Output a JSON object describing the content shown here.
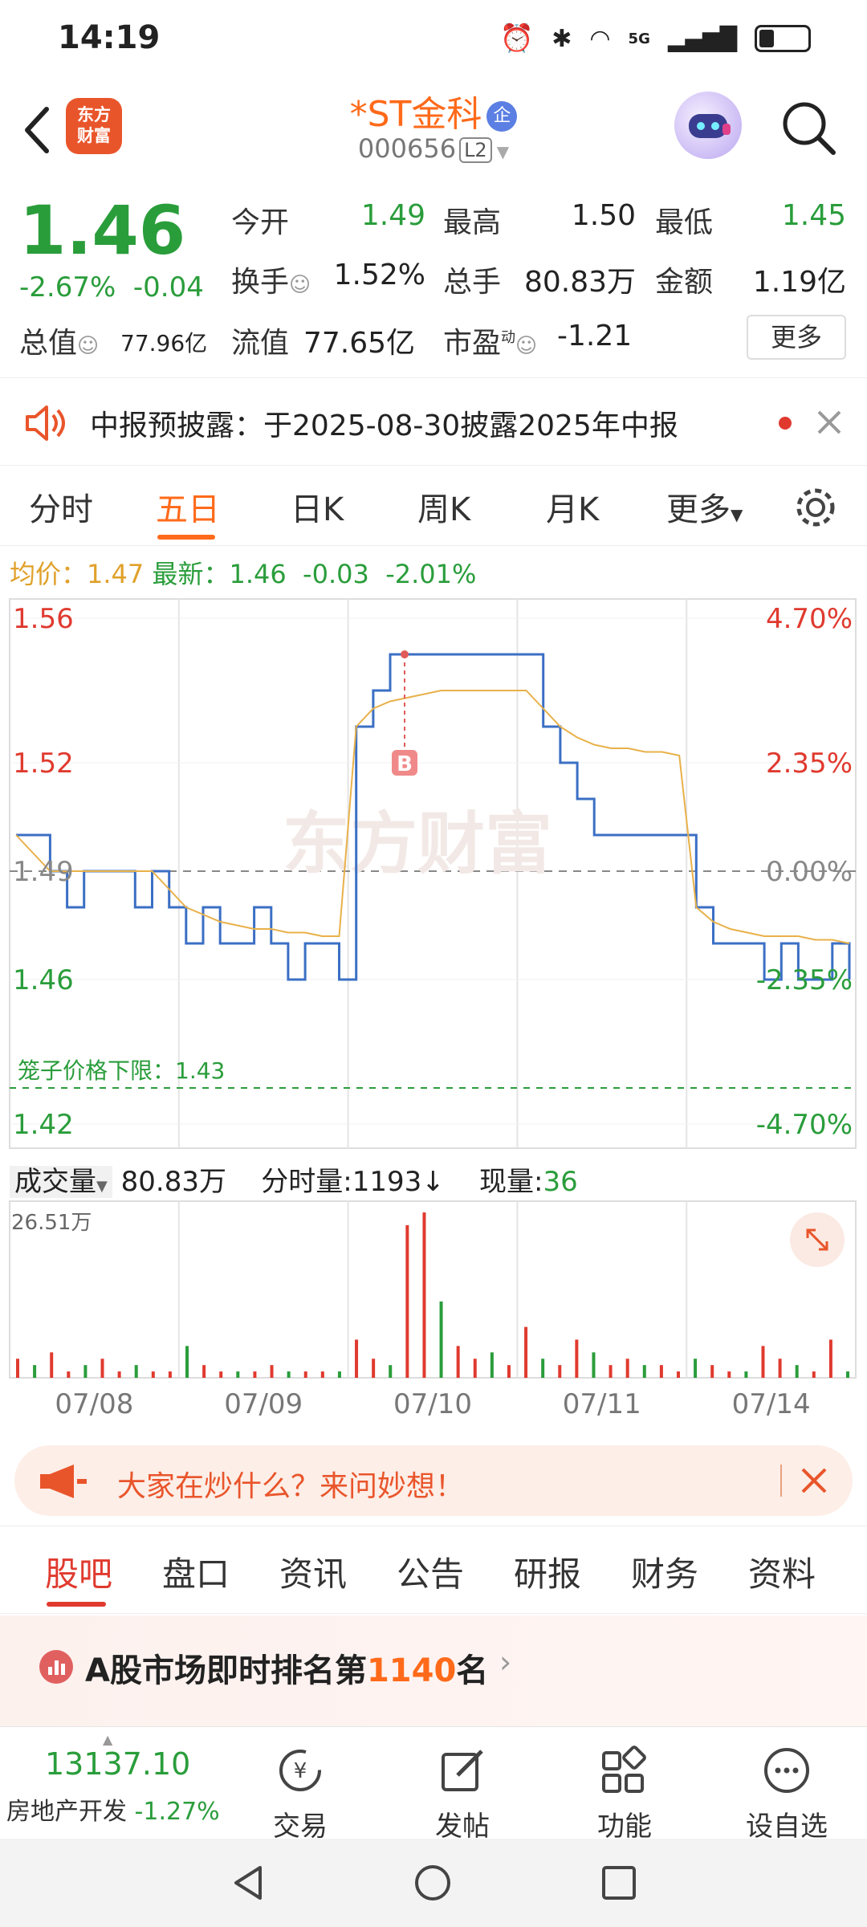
{
  "status": {
    "time": "14:19",
    "network": "5G"
  },
  "header": {
    "brand_logo": "东方财富",
    "stock_name": "*ST金科",
    "corp_badge": "企",
    "stock_code": "000656",
    "level": "L2"
  },
  "quote": {
    "price": "1.46",
    "change_pct": "-2.67%",
    "change": "-0.04",
    "open_label": "今开",
    "open": "1.49",
    "high_label": "最高",
    "high": "1.50",
    "low_label": "最低",
    "low": "1.45",
    "turnover_label": "换手",
    "turnover": "1.52%",
    "volume_label": "总手",
    "volume": "80.83万",
    "amount_label": "金额",
    "amount": "1.19亿",
    "mktcap_label": "总值",
    "mktcap": "77.96亿",
    "float_label": "流值",
    "float_cap": "77.65亿",
    "pe_label": "市盈",
    "pe_sup": "动",
    "pe": "-1.21",
    "more_label": "更多"
  },
  "notice": {
    "text": "中报预披露：于2025-08-30披露2025年中报"
  },
  "chart_tabs": [
    "分时",
    "五日",
    "日K",
    "周K",
    "月K",
    "更多"
  ],
  "avg_row": {
    "avg_label": "均价：",
    "avg": "1.47",
    "latest_label": "最新：",
    "latest": "1.46",
    "chg": "-0.03",
    "pct": "-2.01%"
  },
  "chart_data": {
    "type": "line",
    "x_dates": [
      "07/08",
      "07/09",
      "07/10",
      "07/11",
      "07/14"
    ],
    "y_left_ticks": [
      "1.56",
      "1.52",
      "1.49",
      "1.46",
      "1.42"
    ],
    "y_right_ticks": [
      "4.70%",
      "2.35%",
      "0.00%",
      "-2.35%",
      "-4.70%"
    ],
    "ylim": [
      1.42,
      1.56
    ],
    "prev_close": 1.49,
    "limit_label": "笼子价格下限：1.43",
    "watermark": "东方财富",
    "trade_marker": "B",
    "series": [
      {
        "name": "价格",
        "values": [
          1.5,
          1.5,
          1.49,
          1.48,
          1.49,
          1.49,
          1.49,
          1.48,
          1.49,
          1.48,
          1.47,
          1.48,
          1.47,
          1.47,
          1.48,
          1.47,
          1.46,
          1.47,
          1.47,
          1.46,
          1.53,
          1.54,
          1.55,
          1.55,
          1.55,
          1.55,
          1.55,
          1.55,
          1.55,
          1.55,
          1.55,
          1.53,
          1.52,
          1.51,
          1.5,
          1.5,
          1.5,
          1.5,
          1.5,
          1.5,
          1.48,
          1.47,
          1.47,
          1.47,
          1.46,
          1.47,
          1.46,
          1.46,
          1.47,
          1.46
        ]
      },
      {
        "name": "均价",
        "values": [
          1.5,
          1.495,
          1.49,
          1.49,
          1.49,
          1.49,
          1.49,
          1.49,
          1.49,
          1.485,
          1.48,
          1.478,
          1.476,
          1.475,
          1.474,
          1.474,
          1.473,
          1.473,
          1.472,
          1.472,
          1.53,
          1.535,
          1.537,
          1.538,
          1.539,
          1.54,
          1.54,
          1.54,
          1.54,
          1.54,
          1.54,
          1.535,
          1.53,
          1.527,
          1.525,
          1.524,
          1.524,
          1.523,
          1.523,
          1.522,
          1.48,
          1.476,
          1.474,
          1.473,
          1.472,
          1.472,
          1.472,
          1.471,
          1.471,
          1.47
        ]
      }
    ],
    "volume": {
      "label": "成交量",
      "total": "80.83万",
      "tick_label": "分时量:",
      "tick": "1193",
      "now_label": "现量:",
      "now": "36",
      "max_label": "26.51万",
      "bars": [
        3,
        2,
        4,
        1,
        2,
        3,
        1,
        2,
        1,
        1,
        5,
        2,
        1,
        1,
        1,
        2,
        1,
        1,
        1,
        1,
        6,
        3,
        2,
        24,
        26,
        12,
        5,
        3,
        4,
        2,
        8,
        3,
        2,
        6,
        4,
        2,
        3,
        2,
        2,
        1,
        3,
        2,
        1,
        1,
        5,
        3,
        2,
        1,
        6,
        1
      ]
    }
  },
  "banner": {
    "text": "大家在炒什么？来问妙想！"
  },
  "sub_tabs": [
    "股吧",
    "盘口",
    "资讯",
    "公告",
    "研报",
    "财务",
    "资料"
  ],
  "ranking": {
    "prefix": "A股市场即时排名第",
    "rank": "1140",
    "suffix": "名"
  },
  "bottom_bar": {
    "index_value": "13137.10",
    "index_name": "房地产开发",
    "index_pct": "-1.27%",
    "items": [
      "交易",
      "发帖",
      "功能",
      "设自选"
    ]
  }
}
